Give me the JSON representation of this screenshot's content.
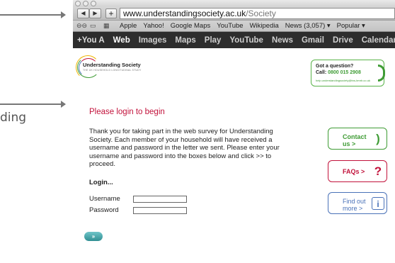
{
  "annotation": {
    "margin_text": "ding"
  },
  "browser": {
    "nav": {
      "back_icon": "back-arrow-icon",
      "forward_icon": "forward-arrow-icon",
      "back_glyph": "◀",
      "forward_glyph": "▶",
      "add_glyph": "+"
    },
    "url": {
      "host": "www.understandingsociety.ac.uk",
      "path": "/Society"
    },
    "bookmarks": {
      "icons": [
        "⊖⊖",
        "▭",
        "▦"
      ],
      "items": [
        "Apple",
        "Yahoo!",
        "Google Maps",
        "YouTube",
        "Wikipedia",
        "News (3,057) ▾",
        "Popular ▾"
      ]
    },
    "google_bar": {
      "items": [
        "+You A",
        "Web",
        "Images",
        "Maps",
        "Play",
        "YouTube",
        "News",
        "Gmail",
        "Drive",
        "Calendar"
      ]
    }
  },
  "page": {
    "logo": {
      "title": "Understanding Society",
      "subtitle": "THE UK HOUSEHOLD LONGITUDINAL STUDY"
    },
    "question_box": {
      "title": "Got a question?",
      "call_prefix": "Call:",
      "phone": "0800 015 2908",
      "email": "help.understandingsociety@tns-bmrb.co.uk"
    },
    "heading": "Please login to begin",
    "body": "Thank you for taking part in the web survey for Understanding Society. Each member of your household will have received a username and password in the letter we sent. Please enter your username and password into the boxes below and click >> to proceed.",
    "login_label": "Login...",
    "username_label": "Username",
    "password_label": "Password",
    "username_value": "",
    "password_value": "",
    "go_label": "»",
    "side_buttons": [
      {
        "label": "Contact us >",
        "color": "#3f9c35",
        "icon": "phone-hook-icon"
      },
      {
        "label": "FAQs >",
        "color": "#c2123b",
        "icon": "question-mark-icon"
      },
      {
        "label": "Find out more >",
        "color": "#4a72b8",
        "icon": "info-icon"
      }
    ]
  },
  "colors": {
    "accent_red": "#c2123b",
    "accent_green": "#3f9c35",
    "accent_blue": "#4a72b8",
    "button_teal": "#318f93"
  }
}
